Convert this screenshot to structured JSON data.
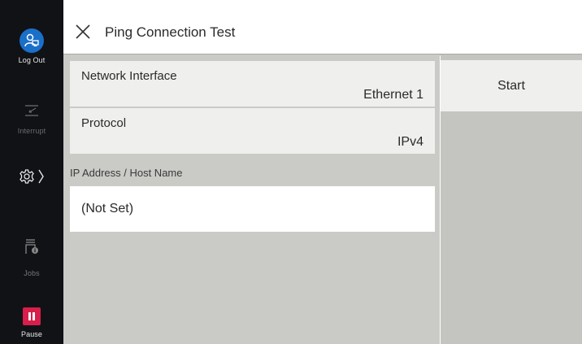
{
  "rail": {
    "logout_label": "Log Out",
    "interrupt_label": "Interrupt",
    "jobs_label": "Jobs",
    "pause_label": "Pause",
    "logout_color": "#1a6fc8",
    "pause_color": "#d81e4a"
  },
  "header": {
    "title": "Ping Connection Test"
  },
  "form": {
    "network_interface": {
      "label": "Network Interface",
      "value": "Ethernet 1"
    },
    "protocol": {
      "label": "Protocol",
      "value": "IPv4"
    },
    "ip_address": {
      "label": "IP Address / Host Name",
      "value": "(Not Set)"
    }
  },
  "actions": {
    "start_label": "Start"
  }
}
